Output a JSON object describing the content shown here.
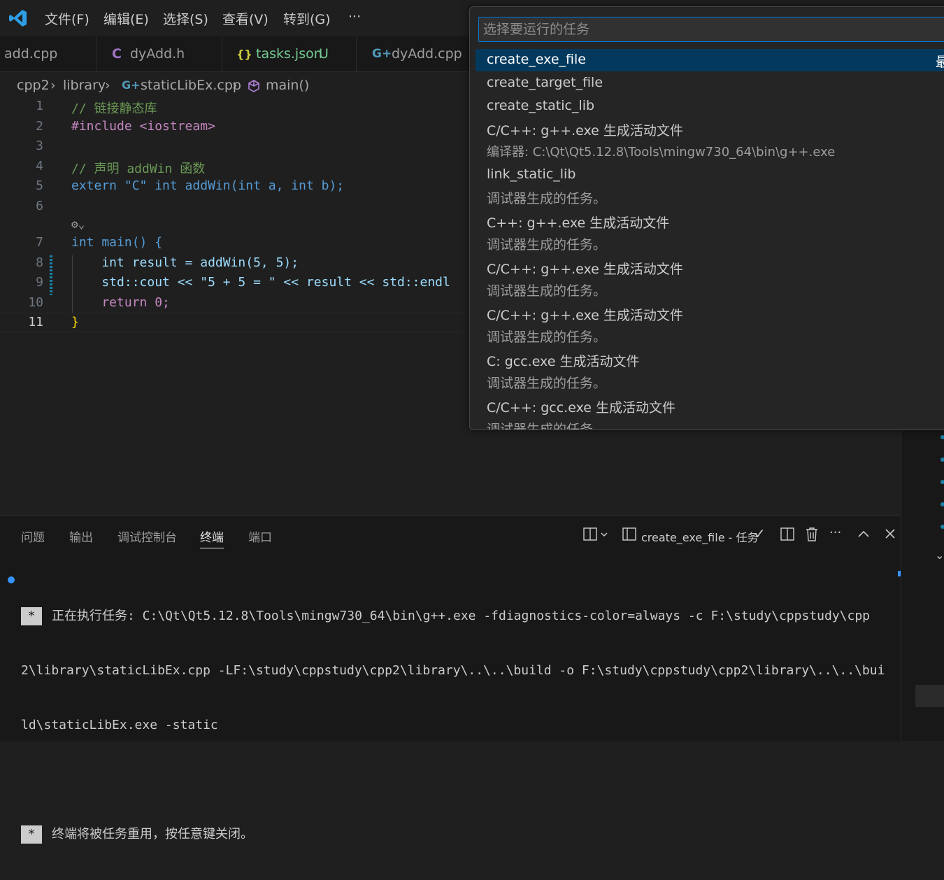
{
  "menu": {
    "items": [
      "文件(F)",
      "编辑(E)",
      "选择(S)",
      "查看(V)",
      "转到(G)"
    ],
    "more": "···"
  },
  "tabs": [
    {
      "label": "add.cpp",
      "icon": "cpp-file-icon",
      "status": ""
    },
    {
      "label": "dyAdd.h",
      "icon": "c-header-icon",
      "status": ""
    },
    {
      "label": "tasks.json",
      "icon": "json-braces-icon",
      "status": "U"
    },
    {
      "label": "dyAdd.cpp",
      "icon": "cpp-file-icon",
      "status": ""
    }
  ],
  "breadcrumb": {
    "parts": [
      "cpp2",
      "library",
      "staticLibEx.cpp",
      "main()"
    ]
  },
  "editor": {
    "line_numbers": [
      "1",
      "2",
      "3",
      "4",
      "5",
      "6",
      "7",
      "8",
      "9",
      "10",
      "11"
    ],
    "lines": [
      "// 链接静态库",
      "#include <iostream>",
      "",
      "// 声明 addWin 函数",
      "extern \"C\" int addWin(int a, int b);",
      "",
      "int main() {",
      "    int result = addWin(5, 5);",
      "    std::cout << \"5 + 5 = \" << result << std::endl",
      "    return 0;",
      "}"
    ]
  },
  "quick_pick": {
    "placeholder": "选择要运行的任务",
    "selected_badge": "最",
    "items": [
      {
        "label": "create_exe_file",
        "detail": ""
      },
      {
        "label": "create_target_file",
        "detail": ""
      },
      {
        "label": "create_static_lib",
        "detail": ""
      },
      {
        "label": "C/C++: g++.exe 生成活动文件",
        "detail": "编译器: C:\\Qt\\Qt5.12.8\\Tools\\mingw730_64\\bin\\g++.exe"
      },
      {
        "label": "link_static_lib",
        "detail": "调试器生成的任务。"
      },
      {
        "label": "C++: g++.exe 生成活动文件",
        "detail": "调试器生成的任务。"
      },
      {
        "label": "C/C++: g++.exe 生成活动文件",
        "detail": "调试器生成的任务。"
      },
      {
        "label": "C/C++: g++.exe 生成活动文件",
        "detail": "调试器生成的任务。"
      },
      {
        "label": "C: gcc.exe 生成活动文件",
        "detail": "调试器生成的任务。"
      },
      {
        "label": "C/C++: gcc.exe 生成活动文件",
        "detail": "调试器生成的任务。"
      }
    ]
  },
  "panel": {
    "tabs": [
      "问题",
      "输出",
      "调试控制台",
      "终端",
      "端口"
    ],
    "active_tab": "终端",
    "terminal_name": "create_exe_file - 任务",
    "terminal_lines": [
      "正在执行任务: C:\\Qt\\Qt5.12.8\\Tools\\mingw730_64\\bin\\g++.exe -fdiagnostics-color=always -c F:\\study\\cppstudy\\cpp",
      "2\\library\\staticLibEx.cpp -LF:\\study\\cppstudy\\cpp2\\library\\..\\..\\build -o F:\\study\\cppstudy\\cpp2\\library\\..\\..\\bui",
      "ld\\staticLibEx.exe -static",
      "终端将被任务重用，按任意键关闭。"
    ],
    "star": "*"
  },
  "colors": {
    "accent": "#0078d4",
    "selection": "#04395e",
    "untracked": "#73c991",
    "json_icon": "#cbcb41",
    "c_icon": "#a074c4",
    "cpp_icon": "#519aba"
  }
}
